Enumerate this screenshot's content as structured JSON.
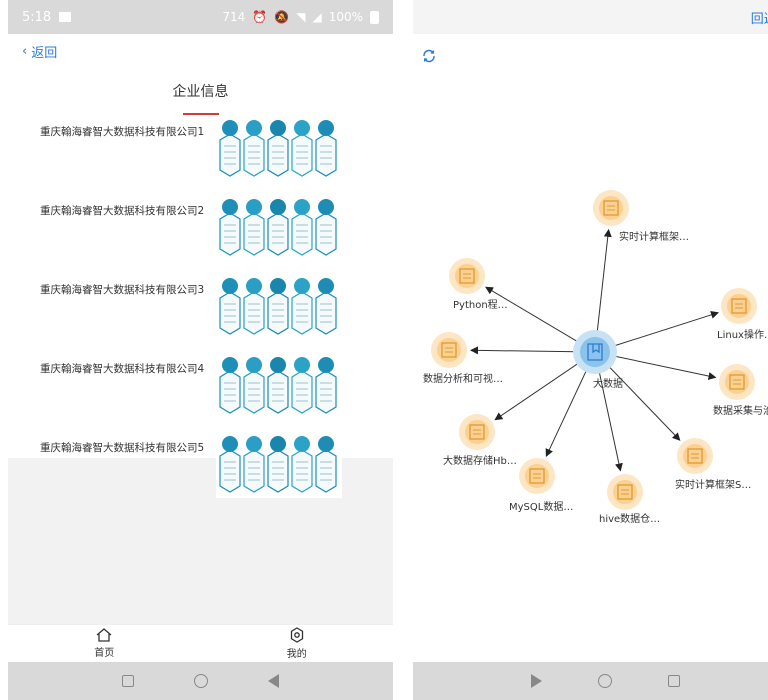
{
  "left": {
    "status": {
      "time": "5:18",
      "net": "714",
      "battery": "100%"
    },
    "nav": {
      "back_label": "返回"
    },
    "header": {
      "title": "企业信息"
    },
    "companies": [
      {
        "name": "重庆翰海睿智大数据科技有限公司1"
      },
      {
        "name": "重庆翰海睿智大数据科技有限公司2"
      },
      {
        "name": "重庆翰海睿智大数据科技有限公司3"
      },
      {
        "name": "重庆翰海睿智大数据科技有限公司4"
      },
      {
        "name": "重庆翰海睿智大数据科技有限公司5"
      }
    ],
    "tabs": [
      {
        "label": "首页",
        "icon": "home-icon"
      },
      {
        "label": "我的",
        "icon": "settings-icon"
      }
    ]
  },
  "right": {
    "nav": {
      "back_label": "回返"
    },
    "graph": {
      "center": "大数据",
      "nodes": [
        "实时计算框架…",
        "Python程…",
        "数据分析和可视…",
        "大数据存储Hb…",
        "MySQL数据…",
        "hive数据仓…",
        "实时计算框架S…",
        "数据采集与治理",
        "Linux操作…"
      ]
    }
  }
}
